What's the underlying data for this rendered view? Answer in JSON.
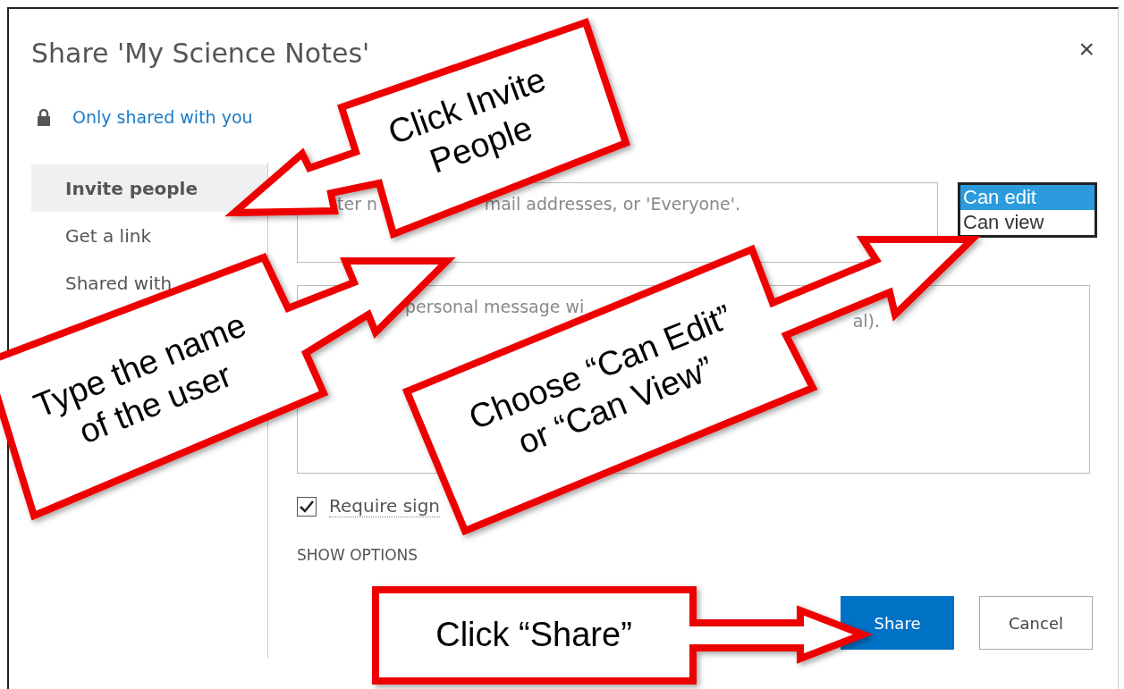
{
  "dialog": {
    "title": "Share 'My Science Notes'",
    "close": "×",
    "sharing_status": "Only shared with you"
  },
  "nav": [
    {
      "label": "Invite people",
      "selected": true
    },
    {
      "label": "Get a link",
      "selected": false
    },
    {
      "label": "Shared with",
      "selected": false
    }
  ],
  "invite_field": {
    "placeholder_parts": [
      "ter n",
      "mail addresses, or 'Everyone'."
    ]
  },
  "permission_list": [
    {
      "label": "Can edit",
      "selected": true
    },
    {
      "label": "Can view",
      "selected": false
    }
  ],
  "message_field": {
    "placeholder_parts": [
      "personal message wi",
      "al)."
    ]
  },
  "require_sign_in": {
    "label": "Require sign",
    "checked": true
  },
  "show_options": "SHOW OPTIONS",
  "buttons": [
    {
      "label": "Share",
      "kind": "primary"
    },
    {
      "label": "Cancel",
      "kind": "secondary"
    }
  ],
  "callouts": [
    {
      "lines": [
        "Click Invite",
        "People"
      ]
    },
    {
      "lines": [
        "Type the name",
        "of the user"
      ]
    },
    {
      "lines": [
        "Choose “Can Edit”",
        "or “Can View”"
      ]
    },
    {
      "lines": [
        "Click “Share”"
      ]
    }
  ]
}
